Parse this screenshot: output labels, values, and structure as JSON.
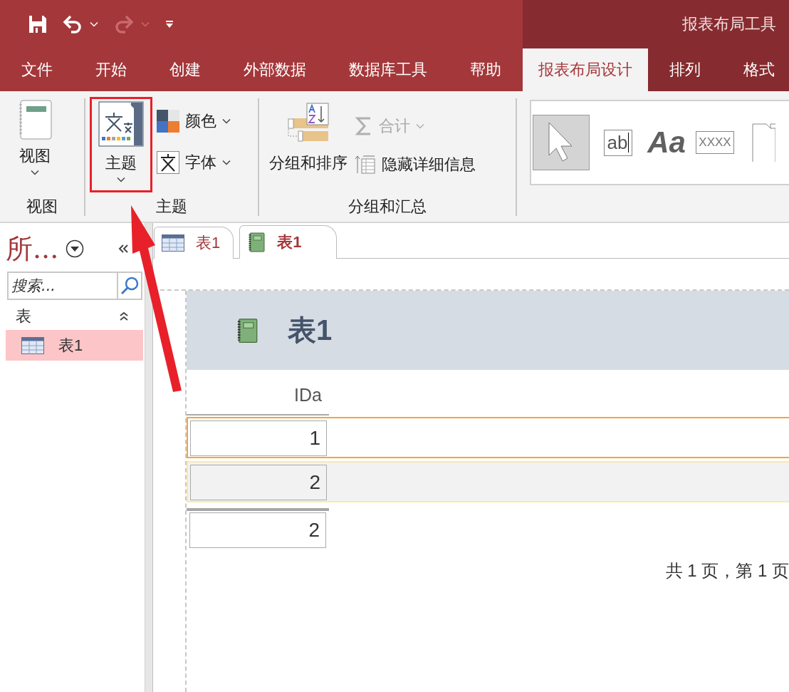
{
  "quick_access": [
    {
      "kind": "save",
      "disabled": false,
      "dropdown": false
    },
    {
      "kind": "undo",
      "disabled": false,
      "dropdown": true
    },
    {
      "kind": "redo",
      "disabled": true,
      "dropdown": true
    },
    {
      "kind": "customize",
      "disabled": false,
      "dropdown": false
    }
  ],
  "context_title": "报表布局工具",
  "ribbon_tabs": [
    {
      "label": "文件",
      "selected": false,
      "contextual": false
    },
    {
      "label": "开始",
      "selected": false,
      "contextual": false
    },
    {
      "label": "创建",
      "selected": false,
      "contextual": false
    },
    {
      "label": "外部数据",
      "selected": false,
      "contextual": false
    },
    {
      "label": "数据库工具",
      "selected": false,
      "contextual": false
    },
    {
      "label": "帮助",
      "selected": false,
      "contextual": false
    },
    {
      "label": "报表布局设计",
      "selected": true,
      "contextual": true
    },
    {
      "label": "排列",
      "selected": false,
      "contextual": true
    },
    {
      "label": "格式",
      "selected": false,
      "contextual": true
    }
  ],
  "ribbon_groups": [
    {
      "kind": "buttons",
      "title": "视图",
      "buttons": [
        {
          "kind": "view",
          "label": "视图",
          "dropdown": true,
          "disabled": false,
          "highlighted": false
        }
      ]
    },
    {
      "kind": "buttons",
      "title": "主题",
      "buttons": [
        {
          "kind": "theme",
          "label": "主题",
          "dropdown": true,
          "disabled": false,
          "highlighted": true
        },
        {
          "kind": "colors",
          "label": "颜色",
          "dropdown": true,
          "disabled": false,
          "highlighted": false
        },
        {
          "kind": "fonts",
          "label": "字体",
          "dropdown": true,
          "disabled": false,
          "highlighted": false
        }
      ]
    },
    {
      "kind": "buttons",
      "title": "分组和汇总",
      "buttons": [
        {
          "kind": "group-sort",
          "label": "分组和排序",
          "dropdown": false,
          "disabled": false,
          "highlighted": false
        },
        {
          "kind": "totals",
          "label": "合计",
          "dropdown": true,
          "disabled": true,
          "highlighted": false
        },
        {
          "kind": "hide-details",
          "label": "隐藏详细信息",
          "dropdown": false,
          "disabled": false,
          "highlighted": false
        }
      ]
    },
    {
      "kind": "gallery",
      "controls": [
        {
          "kind": "select",
          "selected": true
        },
        {
          "kind": "textbox",
          "label": "ab",
          "selected": false
        },
        {
          "kind": "label",
          "label": "Aa",
          "selected": false
        },
        {
          "kind": "button",
          "label": "XXXX",
          "selected": false
        },
        {
          "kind": "tab",
          "selected": false
        }
      ]
    }
  ],
  "nav_pane": {
    "title": "所...",
    "search": {
      "placeholder": "搜索..."
    },
    "groups": [
      {
        "label": "表",
        "expanded": true,
        "items": [
          {
            "label": "表1",
            "selected": true
          }
        ]
      }
    ]
  },
  "document_tabs": [
    {
      "label": "表1",
      "kind": "table",
      "selected": false
    },
    {
      "label": "表1",
      "kind": "report",
      "selected": true
    }
  ],
  "report": {
    "title": "表1",
    "columns": [
      "IDa"
    ],
    "rows": [
      {
        "value": "1",
        "selected": true,
        "hovered": false
      },
      {
        "value": "2",
        "selected": false,
        "hovered": true
      }
    ],
    "total": "2",
    "page_footer": "共 1 页，第 1 页"
  }
}
